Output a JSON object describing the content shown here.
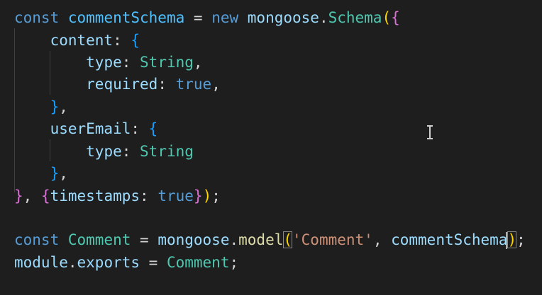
{
  "editor": {
    "language": "javascript",
    "lines": [
      [
        {
          "t": "const",
          "c": "kw"
        },
        {
          "t": " "
        },
        {
          "t": "commentSchema",
          "c": "var"
        },
        {
          "t": " = "
        },
        {
          "t": "new",
          "c": "kw"
        },
        {
          "t": " "
        },
        {
          "t": "mongoose",
          "c": "id"
        },
        {
          "t": "."
        },
        {
          "t": "Schema",
          "c": "cls"
        },
        {
          "t": "(",
          "c": "b1"
        },
        {
          "t": "{",
          "c": "b2"
        }
      ],
      [
        {
          "t": "    "
        },
        {
          "t": "content",
          "c": "id"
        },
        {
          "t": ": "
        },
        {
          "t": "{",
          "c": "b3"
        }
      ],
      [
        {
          "t": "        "
        },
        {
          "t": "type",
          "c": "id"
        },
        {
          "t": ": "
        },
        {
          "t": "String",
          "c": "cls"
        },
        {
          "t": ","
        }
      ],
      [
        {
          "t": "        "
        },
        {
          "t": "required",
          "c": "id"
        },
        {
          "t": ": "
        },
        {
          "t": "true",
          "c": "kw"
        },
        {
          "t": ","
        }
      ],
      [
        {
          "t": "    "
        },
        {
          "t": "}",
          "c": "b3"
        },
        {
          "t": ","
        }
      ],
      [
        {
          "t": "    "
        },
        {
          "t": "userEmail",
          "c": "id"
        },
        {
          "t": ": "
        },
        {
          "t": "{",
          "c": "b3"
        }
      ],
      [
        {
          "t": "        "
        },
        {
          "t": "type",
          "c": "id"
        },
        {
          "t": ": "
        },
        {
          "t": "String",
          "c": "cls"
        }
      ],
      [
        {
          "t": "    "
        },
        {
          "t": "}",
          "c": "b3"
        },
        {
          "t": ","
        }
      ],
      [
        {
          "t": "}",
          "c": "b2"
        },
        {
          "t": ", "
        },
        {
          "t": "{",
          "c": "b2"
        },
        {
          "t": "timestamps",
          "c": "id"
        },
        {
          "t": ": "
        },
        {
          "t": "true",
          "c": "kw"
        },
        {
          "t": "}",
          "c": "b2"
        },
        {
          "t": ")",
          "c": "b1"
        },
        {
          "t": ";"
        }
      ],
      [],
      [
        {
          "t": "const",
          "c": "kw"
        },
        {
          "t": " "
        },
        {
          "t": "Comment",
          "c": "cls"
        },
        {
          "t": " = "
        },
        {
          "t": "mongoose",
          "c": "id"
        },
        {
          "t": "."
        },
        {
          "t": "model",
          "c": "fn"
        },
        {
          "t": "(",
          "c": "b1",
          "m": true
        },
        {
          "t": "'Comment'",
          "c": "str"
        },
        {
          "t": ", "
        },
        {
          "t": "commentSchema",
          "c": "id"
        },
        {
          "t": ")",
          "c": "b1",
          "m": true,
          "cursor": true
        },
        {
          "t": ";"
        }
      ],
      [
        {
          "t": "module",
          "c": "id"
        },
        {
          "t": "."
        },
        {
          "t": "exports",
          "c": "id"
        },
        {
          "t": " = "
        },
        {
          "t": "Comment",
          "c": "cls"
        },
        {
          "t": ";"
        }
      ]
    ]
  },
  "colors": {
    "background": "#1e1e1e",
    "keyword": "#569cd6",
    "constant": "#4fc1ff",
    "identifier": "#9cdcfe",
    "function": "#dcdcaa",
    "type": "#4ec9b0",
    "string": "#ce9178",
    "bracket_level_1": "#ffd700",
    "bracket_level_2": "#da70d6",
    "bracket_level_3": "#179fff"
  },
  "mouse_pointer": "text-ibeam-cursor-icon"
}
